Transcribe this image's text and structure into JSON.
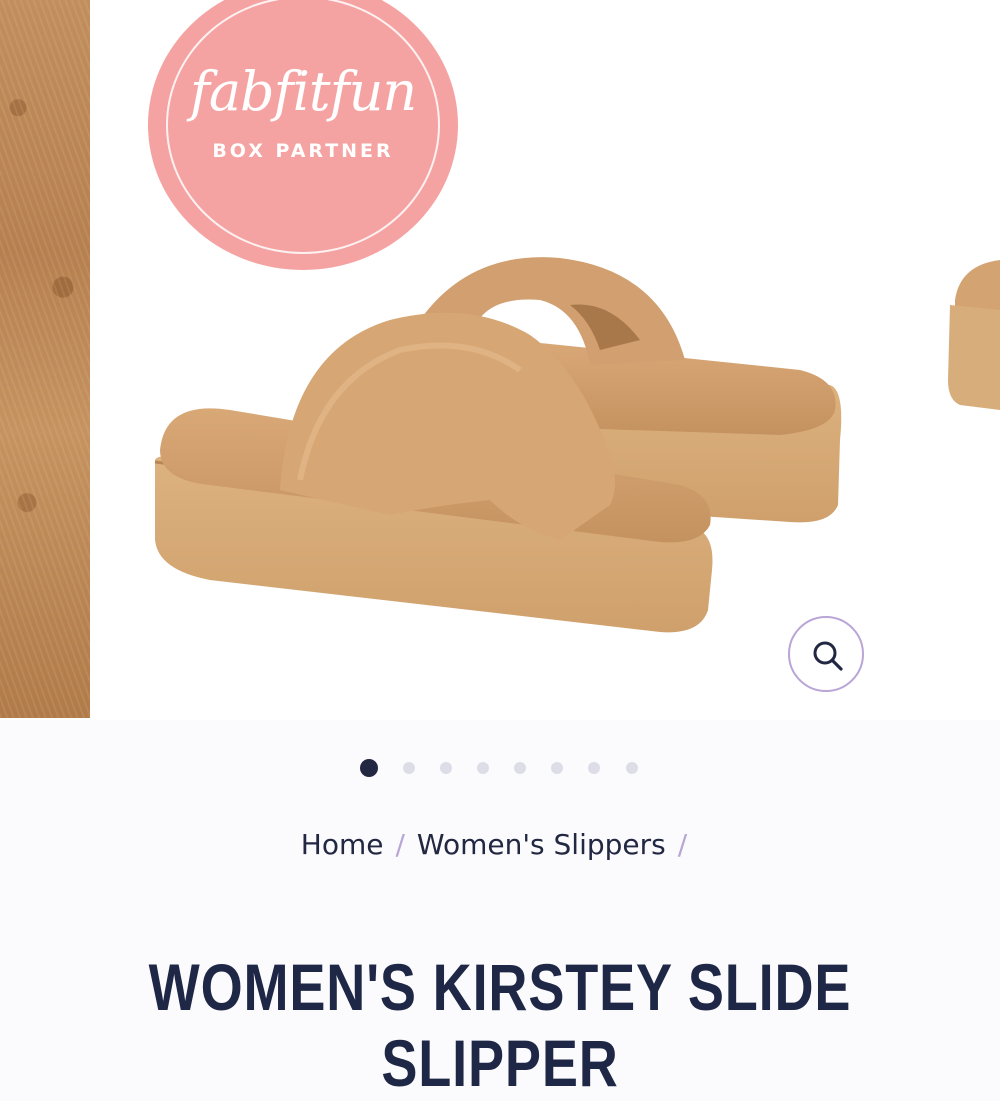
{
  "badge": {
    "brand": "fabfitfun",
    "subtitle": "BOX PARTNER",
    "color": "#f5a3a2"
  },
  "gallery": {
    "slide_count": 8,
    "active_slide": 1,
    "zoom_icon": "search-icon",
    "accent_color": "#b9a5d6"
  },
  "breadcrumb": {
    "items": [
      "Home",
      "Women's Slippers"
    ],
    "separator": "/"
  },
  "product": {
    "title": "WOMEN'S KIRSTEY SLIDE SLIPPER"
  },
  "colors": {
    "navy": "#222742",
    "dot_inactive": "#dcdde6"
  }
}
